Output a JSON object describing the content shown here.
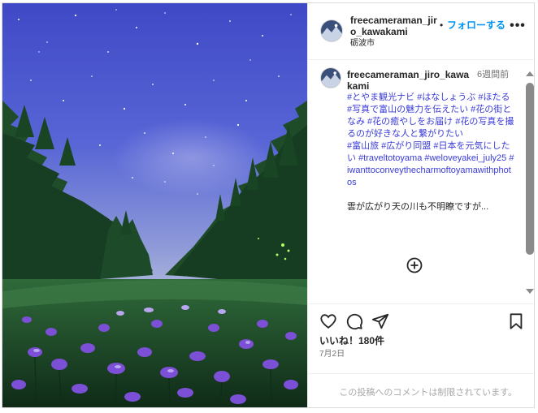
{
  "header": {
    "username": "freecameraman_jiro_kawakami",
    "separator": "•",
    "follow_label": "フォローする",
    "location": "砺波市",
    "more_label": "•••"
  },
  "caption": {
    "username": "freecameraman_jiro_kawakami",
    "time": "6週間前",
    "tags_line1": "#とやま観光ナビ #はなしょうぶ #ほたる #写真で富山の魅力を伝えたい #花の街となみ #花の癒やしをお届け #花の写真を撮るのが好きな人と繋がりたい",
    "tags_line2": "#富山旅 #広がり同盟 #日本を元気にしたい #traveltotoyama #weloveyakei_july25 #iwanttoconveythecharmoftoyamawithphotos",
    "text": "雲が広がり天の川も不明瞭ですが..."
  },
  "actions": {
    "likes": "いいね！180件",
    "date": "7月2日"
  },
  "comments_disabled": "この投稿へのコメントは制限されています。",
  "colors": {
    "follow": "#0095f6",
    "hashtag": "#3a3bd8",
    "sky": "#4e59c8",
    "iris": "#7b4fd6"
  }
}
